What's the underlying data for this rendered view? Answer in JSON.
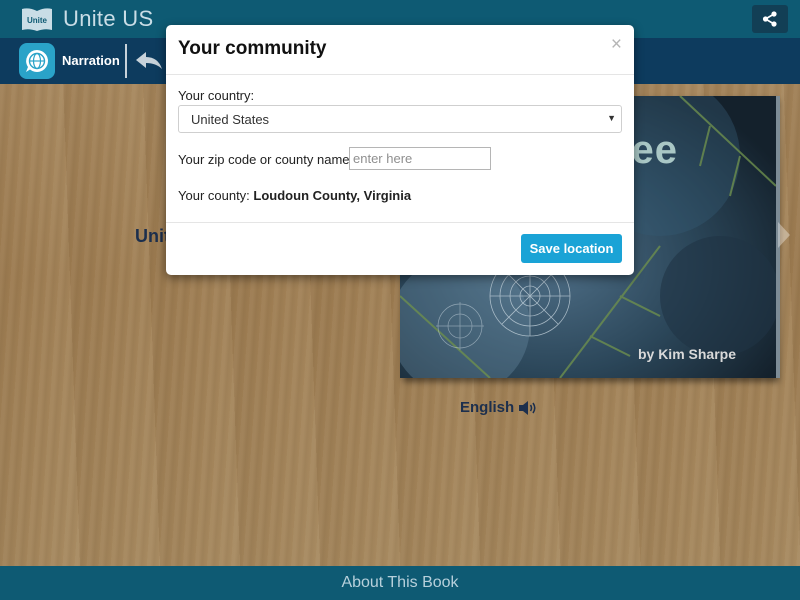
{
  "header": {
    "logo_text": "Unite",
    "title": "Unite US",
    "share_icon": "share-icon"
  },
  "toolbar": {
    "narration_label": "Narration",
    "narration_icon": "globe-chat-icon",
    "back_icon": "back-arrow-icon"
  },
  "page": {
    "partial_title": "Unit",
    "book": {
      "title_partial": "ee",
      "author": "by Kim Sharpe"
    },
    "language": "English"
  },
  "footer": {
    "about_label": "About This Book"
  },
  "modal": {
    "title": "Your community",
    "close_glyph": "×",
    "country_label": "Your country:",
    "country_value": "United States",
    "zip_label": "Your zip code or county name:",
    "zip_placeholder": "enter here",
    "zip_value": "",
    "county_prefix": "Your county:",
    "county_value": "Loudoun County, Virginia",
    "save_label": "Save location"
  },
  "colors": {
    "header_bg": "#0e5a73",
    "toolbar_bg": "#0d3b5e",
    "accent": "#1aa3d6"
  }
}
